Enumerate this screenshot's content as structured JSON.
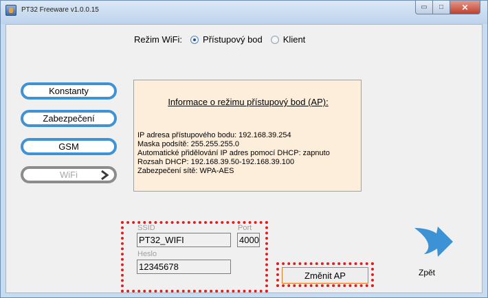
{
  "window": {
    "title": "PT32 Freeware v1.0.0.15",
    "minimize_glyph": "▭",
    "maximize_glyph": "□",
    "close_glyph": "✕"
  },
  "wifi_mode": {
    "label": "Režim WiFi:",
    "options": [
      {
        "label": "Přístupový bod",
        "selected": true
      },
      {
        "label": "Klient",
        "selected": false
      }
    ]
  },
  "nav": {
    "items": [
      {
        "label": "Konstanty",
        "enabled": true
      },
      {
        "label": "Zabezpečení",
        "enabled": true
      },
      {
        "label": "GSM",
        "enabled": true
      },
      {
        "label": "WiFi",
        "enabled": false,
        "icon": "chevron-right-icon"
      }
    ]
  },
  "info": {
    "heading": "Informace o režimu přístupový bod (AP):",
    "lines": [
      "IP adresa přístupového bodu: 192.168.39.254",
      "Maska podsítě: 255.255.255.0",
      "Automatické přidělování IP adres pomocí DHCP: zapnuto",
      "Rozsah DHCP: 192.168.39.50-192.168.39.100",
      "Zabezpečení sítě: WPA-AES"
    ]
  },
  "credentials": {
    "ssid_label": "SSID",
    "ssid_value": "PT32_WIFI",
    "port_label": "Port",
    "port_value": "4000",
    "password_label": "Heslo",
    "password_value": "12345678"
  },
  "actions": {
    "change_ap_label": "Změnit AP",
    "back_label": "Zpět",
    "back_icon": "arrow-back-icon"
  },
  "colors": {
    "nav_border": "#3f92d3",
    "info_background": "#fdeedb",
    "highlight_dotted": "#e02020",
    "change_button_border": "#e47a1f",
    "back_arrow": "#3b93d6"
  }
}
